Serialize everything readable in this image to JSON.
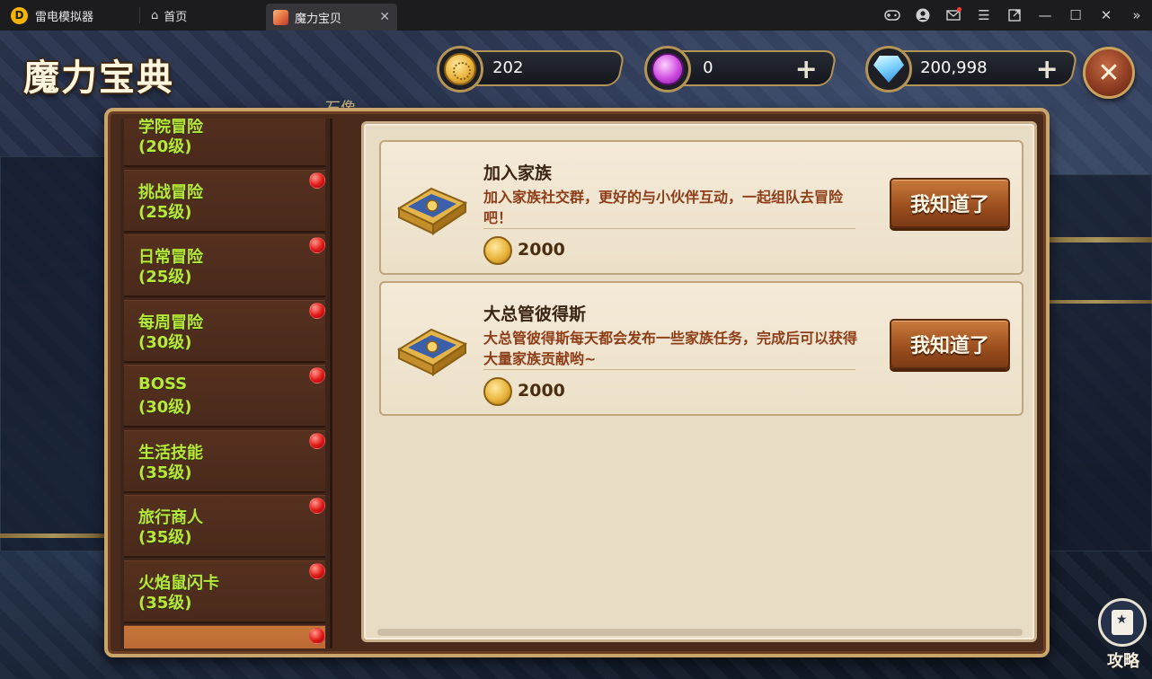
{
  "emulator": {
    "app_name": "雷电模拟器",
    "logo_letter": "D",
    "tabs": [
      {
        "label": "首页"
      },
      {
        "label": "魔力宝贝"
      }
    ],
    "toolbar_icons": [
      "gamepad-icon",
      "account-icon",
      "mail-icon",
      "menu-icon",
      "external-icon",
      "minimize-icon",
      "maximize-icon",
      "close-icon",
      "collapse-icon"
    ]
  },
  "game": {
    "page_title": "魔力宝典",
    "background_label": "石像",
    "currencies": [
      {
        "name": "coin",
        "value": "202",
        "icon": "gold-coin-icon"
      },
      {
        "name": "gem",
        "value": "0",
        "icon": "purple-gem-icon",
        "plus": "+"
      },
      {
        "name": "diamond",
        "value": "200,998",
        "icon": "diamond-icon",
        "plus": "+"
      }
    ],
    "close_label": "✕",
    "sidebar": [
      {
        "name": "学院冒险",
        "level": "(20级)"
      },
      {
        "name": "挑战冒险",
        "level": "(25级)"
      },
      {
        "name": "日常冒险",
        "level": "(25级)"
      },
      {
        "name": "每周冒险",
        "level": "(30级)"
      },
      {
        "name": "BOSS",
        "level": "(30级)"
      },
      {
        "name": "生活技能",
        "level": "(35级)"
      },
      {
        "name": "旅行商人",
        "level": "(35级)"
      },
      {
        "name": "火焰鼠闪卡",
        "level": "(35级)"
      }
    ],
    "cards": [
      {
        "title": "加入家族",
        "description": "加入家族社交群，更好的与小伙伴互动，一起组队去冒险吧！",
        "reward": "2000",
        "button": "我知道了"
      },
      {
        "title": "大总管彼得斯",
        "description": "大总管彼得斯每天都会发布一些家族任务，完成后可以获得大量家族贡献哟~",
        "reward": "2000",
        "button": "我知道了"
      }
    ],
    "guide_label": "攻略"
  }
}
